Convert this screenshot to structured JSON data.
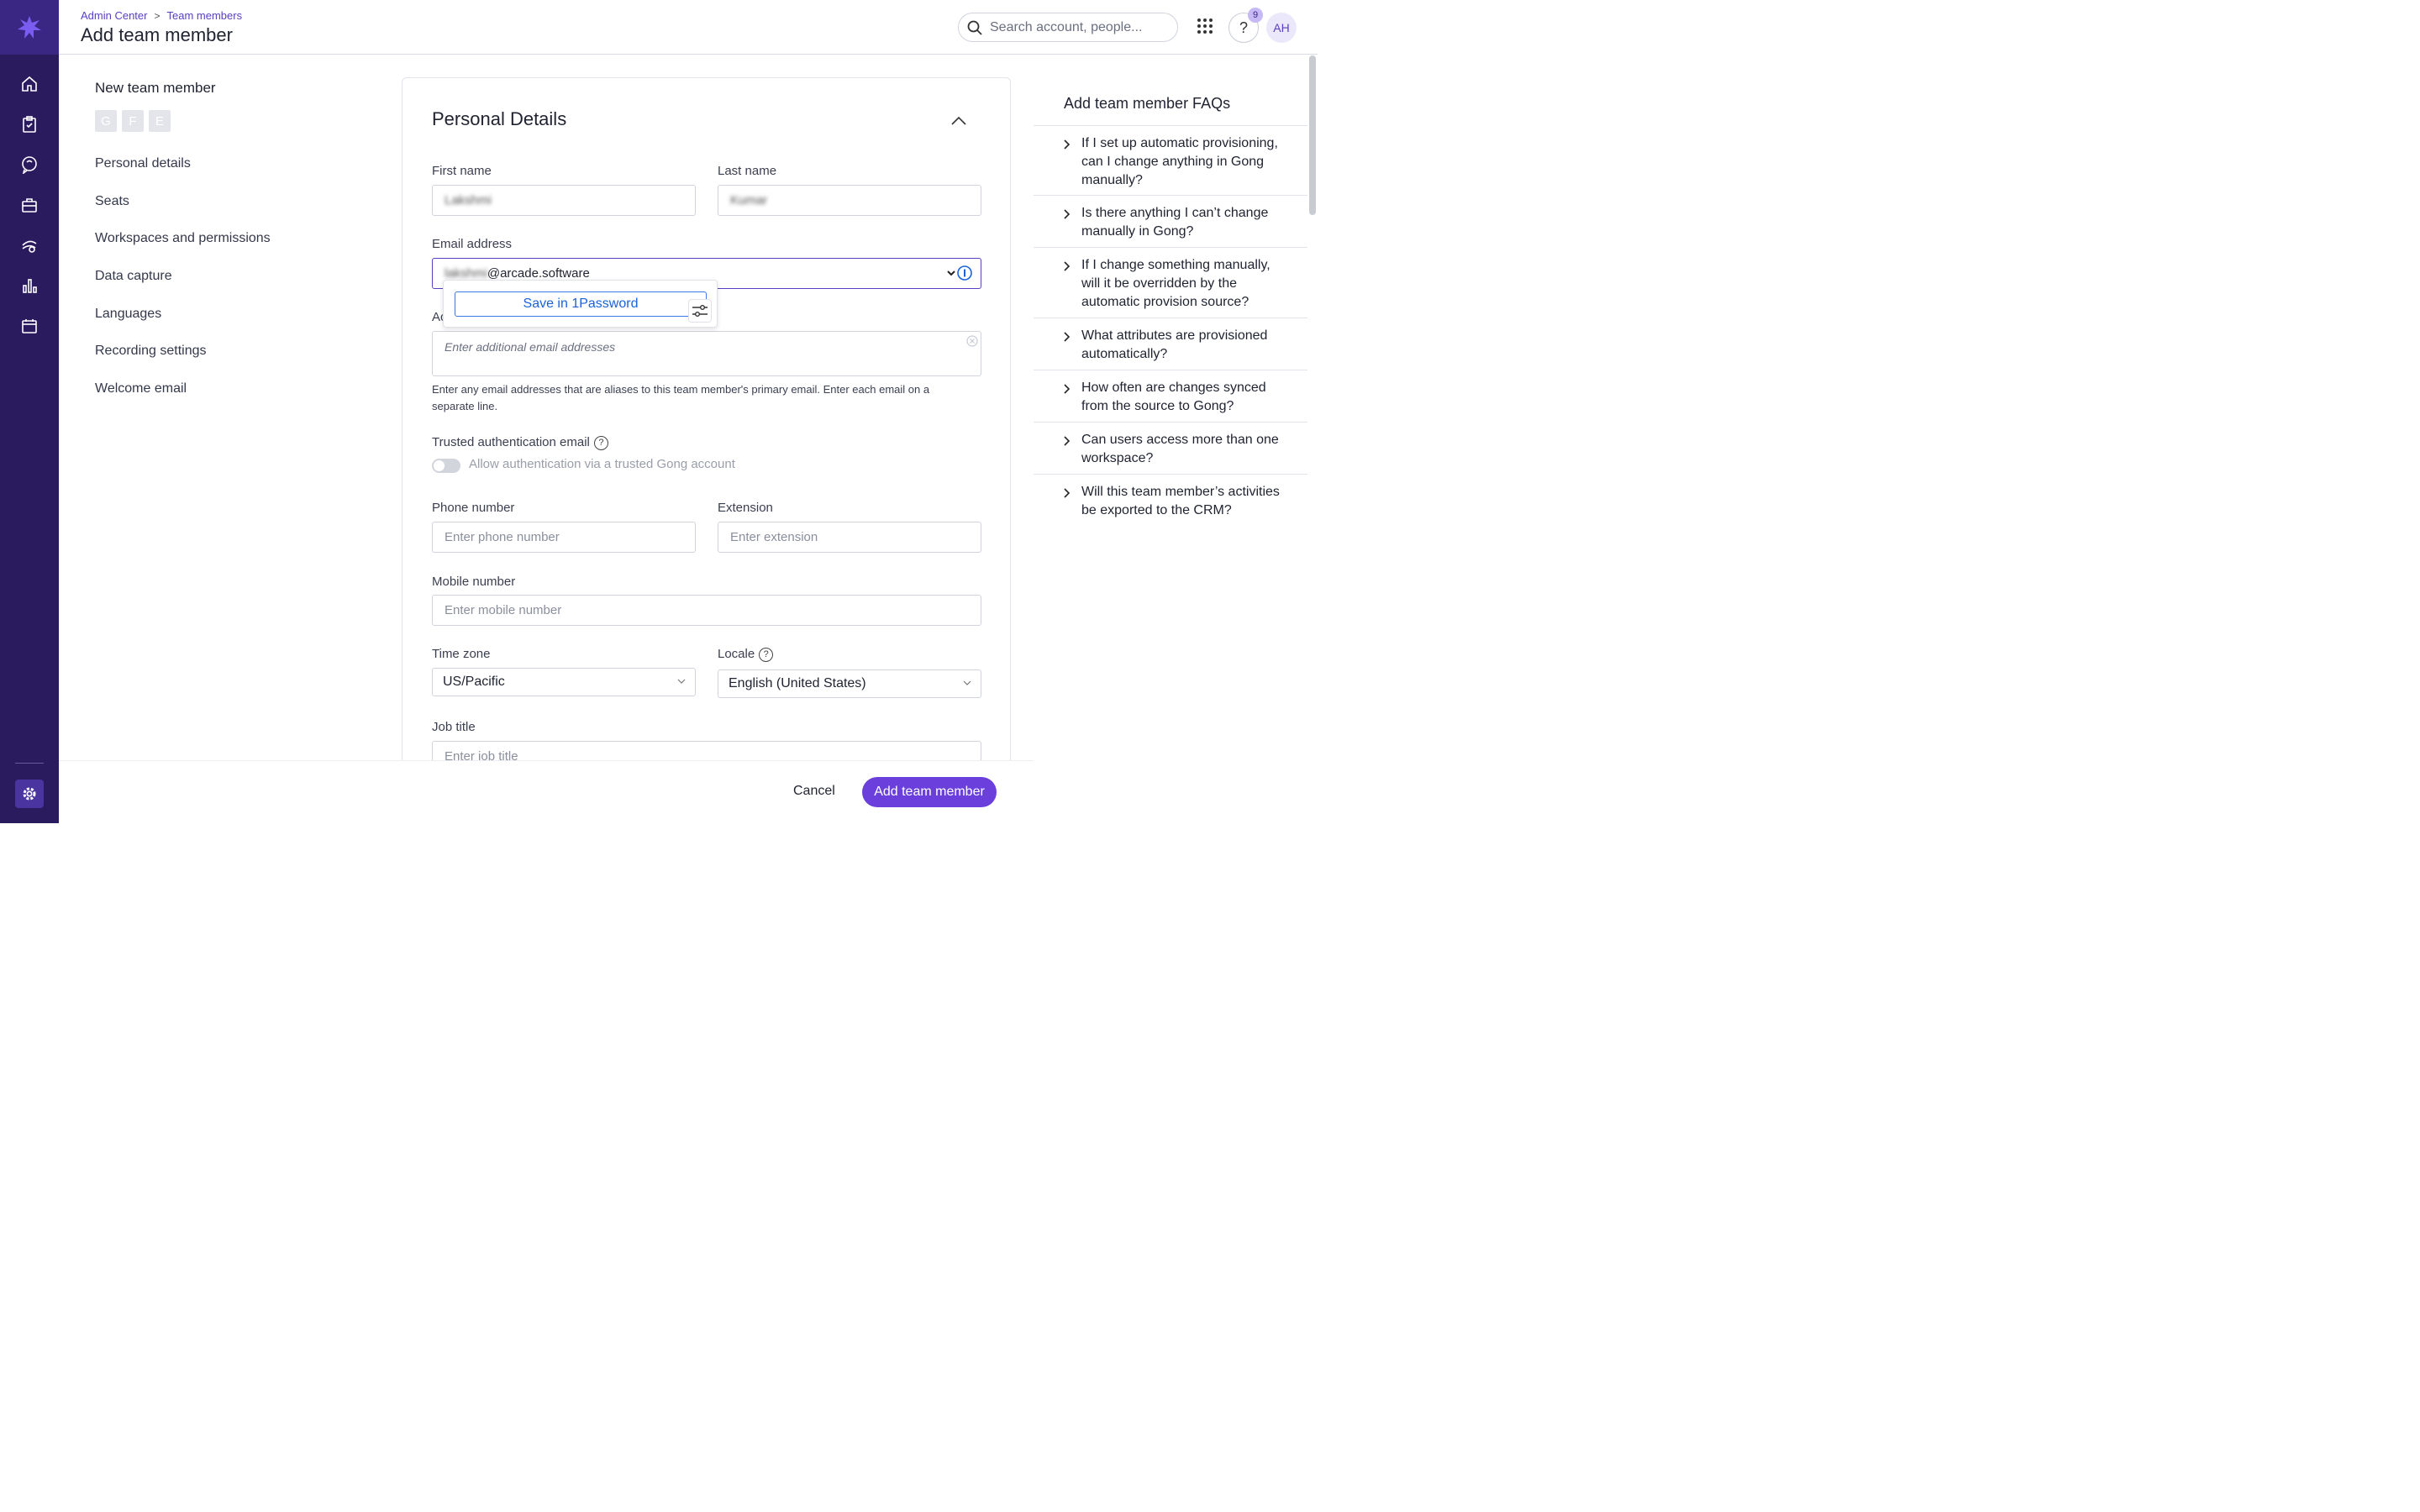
{
  "breadcrumb": {
    "item1": "Admin Center",
    "item2": "Team members"
  },
  "header": {
    "title": "Add team member",
    "search_placeholder": "Search account, people...",
    "help_label": "?",
    "help_badge": "9",
    "avatar_initials": "AH"
  },
  "section_nav": {
    "title": "New team member",
    "initials": [
      "G",
      "F",
      "E"
    ],
    "items": [
      "Personal details",
      "Seats",
      "Workspaces and permissions",
      "Data capture",
      "Languages",
      "Recording settings",
      "Welcome email"
    ]
  },
  "form": {
    "title": "Personal Details",
    "first_name_label": "First name",
    "first_name_value": "Lakshmi",
    "last_name_label": "Last name",
    "last_name_value": "Kumar",
    "email_label": "Email address",
    "email_user_value": "lakshmi",
    "email_domain_value": "@arcade.software",
    "additional_label": "Ac",
    "additional_placeholder": "Enter additional email addresses",
    "additional_hint": "Enter any email addresses that are aliases to this team member's primary email. Enter each email on a separate line.",
    "trusted_label": "Trusted authentication email",
    "trusted_toggle_label": "Allow authentication via a trusted Gong account",
    "phone_label": "Phone number",
    "phone_placeholder": "Enter phone number",
    "extension_label": "Extension",
    "extension_placeholder": "Enter extension",
    "mobile_label": "Mobile number",
    "mobile_placeholder": "Enter mobile number",
    "timezone_label": "Time zone",
    "timezone_value": "US/Pacific",
    "locale_label": "Locale",
    "locale_value": "English (United States)",
    "jobtitle_label": "Job title",
    "jobtitle_placeholder": "Enter job title"
  },
  "onepassword": {
    "save_label": "Save in 1Password"
  },
  "footer": {
    "cancel_label": "Cancel",
    "add_label": "Add team member"
  },
  "faq": {
    "title": "Add team member FAQs",
    "items": [
      "If I set up automatic provisioning, can I change anything in Gong manually?",
      "Is there anything I can’t change manually in Gong?",
      "If I change something manually, will it be overridden by the automatic provision source?",
      "What attributes are provisioned automatically?",
      "How often are changes synced from the source to Gong?",
      "Can users access more than one workspace?",
      "Will this team member’s activities be exported to the CRM?"
    ]
  },
  "colors": {
    "rail": "#2a1a5e",
    "accent": "#6a3fdc",
    "link": "#5a3fc0"
  }
}
